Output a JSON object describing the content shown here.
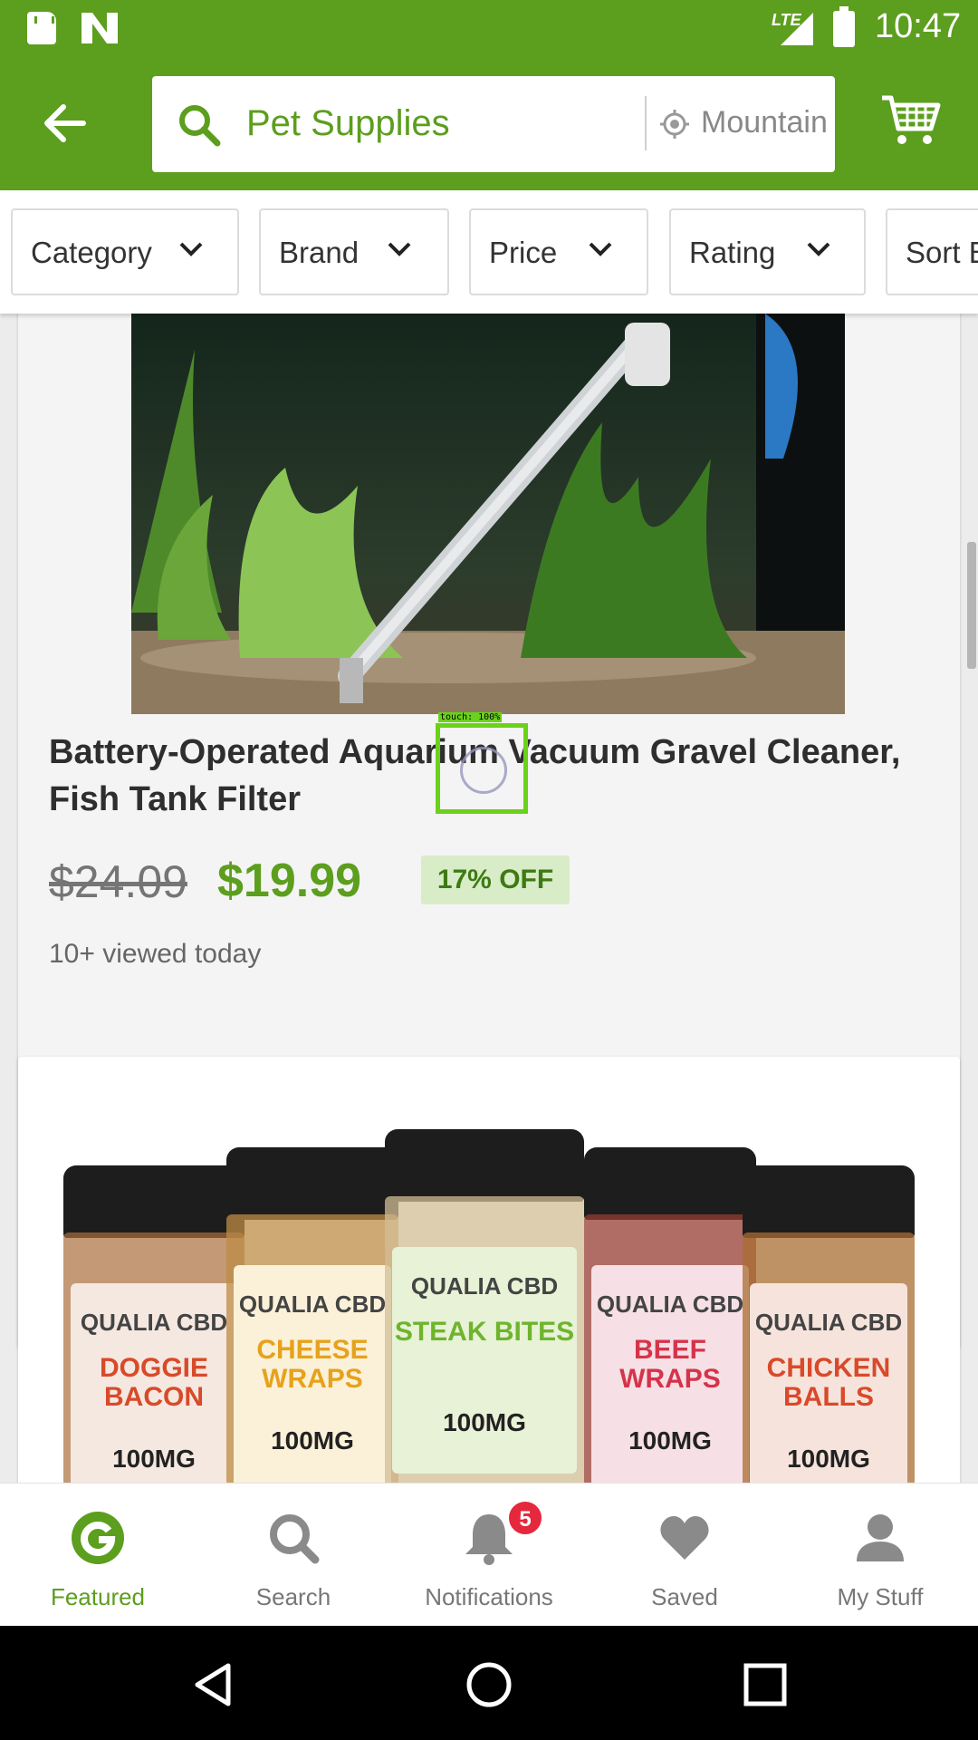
{
  "status_bar": {
    "network": "LTE",
    "time": "10:47"
  },
  "app_bar": {
    "search_query": "Pet Supplies",
    "location_text": "Mountain View",
    "icons": [
      "back-arrow-icon",
      "search-icon",
      "location-icon",
      "cart-icon"
    ]
  },
  "filters": [
    {
      "label": "Category"
    },
    {
      "label": "Brand"
    },
    {
      "label": "Price"
    },
    {
      "label": "Rating"
    },
    {
      "label": "Sort By"
    }
  ],
  "product1": {
    "title": "Battery-Operated Aquarium Vacuum Gravel Cleaner, Fish Tank Filter",
    "old_price": "$24.09",
    "new_price": "$19.99",
    "discount": "17% OFF",
    "viewed": "10+ viewed today"
  },
  "product2": {
    "jars": [
      {
        "brand": "QUALIA CBD",
        "flavor": "DOGGIE BACON",
        "mg": "100MG",
        "color": "#d84a2a"
      },
      {
        "brand": "QUALIA CBD",
        "flavor": "CHEESE WRAPS",
        "mg": "100MG",
        "color": "#e6a21c"
      },
      {
        "brand": "QUALIA CBD",
        "flavor": "STEAK BITES",
        "mg": "100MG",
        "color": "#6fb42c"
      },
      {
        "brand": "QUALIA CBD",
        "flavor": "BEEF WRAPS",
        "mg": "100MG",
        "color": "#d6334a"
      },
      {
        "brand": "QUALIA CBD",
        "flavor": "CHICKEN BALLS",
        "mg": "100MG",
        "color": "#d84a2a"
      }
    ]
  },
  "touch_overlay": {
    "label": "touch: 100%"
  },
  "bottom_nav": [
    {
      "label": "Featured",
      "icon": "featured-g-icon",
      "active": true
    },
    {
      "label": "Search",
      "icon": "search-icon"
    },
    {
      "label": "Notifications",
      "icon": "bell-icon",
      "badge": "5"
    },
    {
      "label": "Saved",
      "icon": "heart-icon"
    },
    {
      "label": "My Stuff",
      "icon": "person-icon"
    }
  ],
  "colors": {
    "brand_green": "#5c9e1e",
    "badge_red": "#e5283c"
  }
}
